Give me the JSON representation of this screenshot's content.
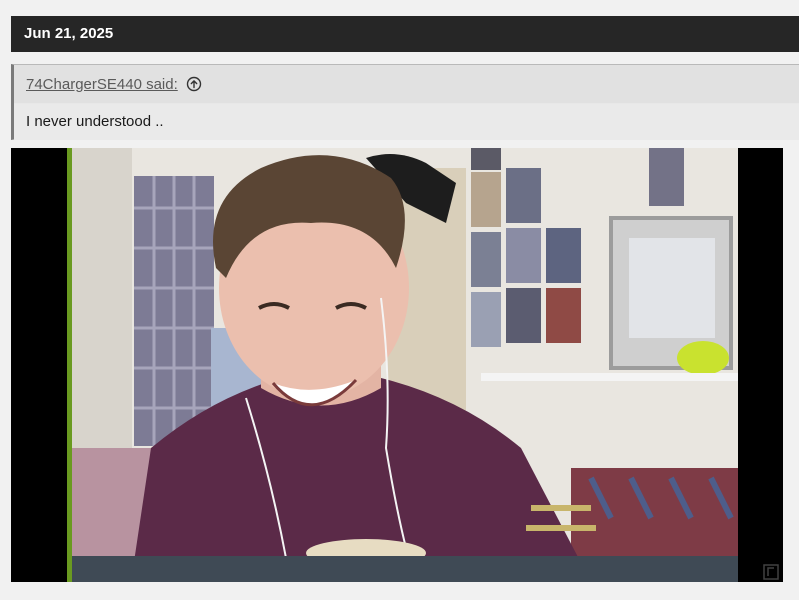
{
  "post": {
    "date": "Jun 21, 2025"
  },
  "quote": {
    "author_said": "74ChargerSE440 said:",
    "icon": "arrow-up-circle-icon",
    "text": "I never understood .."
  },
  "media": {
    "description_icon": "video-embed",
    "accent_colors": {
      "shirt": "#5b2a48",
      "wall": "#ece9e4",
      "tennis_ball": "#c9e22f"
    }
  }
}
